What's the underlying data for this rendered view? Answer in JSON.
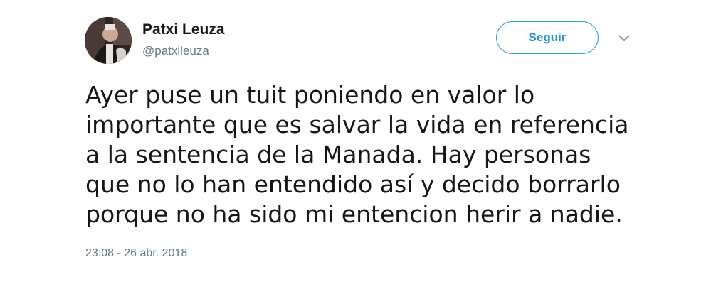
{
  "author": {
    "name": "Patxi Leuza",
    "handle": "@patxileuza",
    "avatar_icon": "user-avatar-photo"
  },
  "actions": {
    "follow_label": "Seguir",
    "more_icon": "chevron-down-icon"
  },
  "tweet": {
    "lines": [
      "Ayer puse un tuit poniendo en valor lo",
      "importante que es salvar la vida en referencia",
      "a la sentencia de la Manada. Hay personas",
      "que no lo han entendido así y decido borrarlo",
      "porque no ha sido mi entencion herir a nadie."
    ],
    "timestamp": "23:08 - 26 abr. 2018"
  },
  "colors": {
    "accent": "#1da1f2",
    "follow_text": "#1b95e0",
    "text_primary": "#14171a",
    "text_secondary": "#657786"
  }
}
